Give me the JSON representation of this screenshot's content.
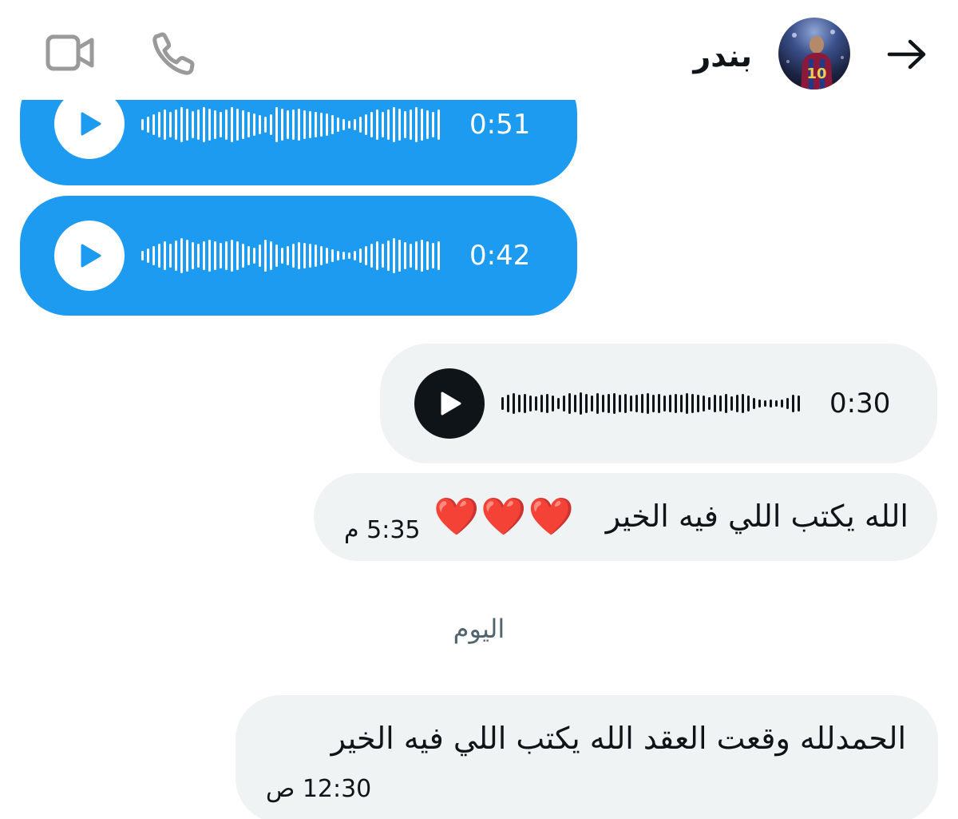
{
  "header": {
    "contact_name": "بندر",
    "icons": {
      "back": "arrow-right-icon",
      "phone": "phone-icon",
      "video": "video-camera-icon"
    }
  },
  "messages": {
    "voice1": {
      "duration": "0:51",
      "color": "#1d9bf0"
    },
    "voice2": {
      "duration": "0:42",
      "color": "#1d9bf0"
    },
    "voice3": {
      "duration": "0:30",
      "color": "#eff3f4"
    },
    "text1": {
      "text": "الله يكتب اللي فيه الخير",
      "hearts": "❤️❤️❤️",
      "time": "5:35 م"
    },
    "day_separator": "اليوم",
    "text2": {
      "text": "الحمدلله وقعت العقد الله يكتب اللي فيه الخير",
      "time": "12:30 ص"
    }
  },
  "colors": {
    "accent": "#1d9bf0",
    "bubble_grey": "#eff3f4",
    "text": "#0f1419",
    "muted": "#536471",
    "heart": "#e3232a"
  }
}
